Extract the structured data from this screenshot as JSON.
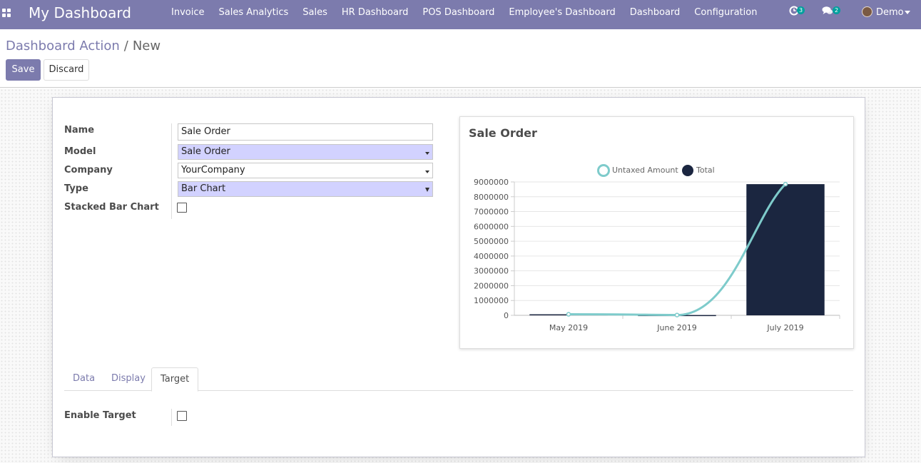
{
  "navbar": {
    "brand": "My Dashboard",
    "menu": [
      "Invoice",
      "Sales Analytics",
      "Sales",
      "HR Dashboard",
      "POS Dashboard",
      "Employee's Dashboard",
      "Dashboard",
      "Configuration"
    ],
    "activity_count": "3",
    "messages_count": "2",
    "user": "Demo"
  },
  "breadcrumb": {
    "parent": "Dashboard Action",
    "separator": "/",
    "current": "New"
  },
  "buttons": {
    "save": "Save",
    "discard": "Discard"
  },
  "form": {
    "name_label": "Name",
    "name_value": "Sale Order",
    "model_label": "Model",
    "model_value": "Sale Order",
    "company_label": "Company",
    "company_value": "YourCompany",
    "type_label": "Type",
    "type_value": "Bar Chart",
    "stacked_label": "Stacked Bar Chart",
    "stacked_checked": false
  },
  "tabs": {
    "data": "Data",
    "display": "Display",
    "target": "Target",
    "active": "Target"
  },
  "target": {
    "enable_label": "Enable Target",
    "enable_checked": false
  },
  "chart_data": {
    "type": "bar",
    "title": "Sale Order",
    "categories": [
      "May 2019",
      "June 2019",
      "July 2019"
    ],
    "series": [
      {
        "name": "Untaxed Amount",
        "type": "line",
        "values": [
          70000,
          20000,
          8850000
        ],
        "color": "#7ecbcb"
      },
      {
        "name": "Total",
        "type": "bar",
        "values": [
          70000,
          20000,
          8850000
        ],
        "color": "#1b2640"
      }
    ],
    "ylim": [
      0,
      9000000
    ],
    "yticks": [
      "0",
      "1000000",
      "2000000",
      "3000000",
      "4000000",
      "5000000",
      "6000000",
      "7000000",
      "8000000",
      "9000000"
    ],
    "legend": "top",
    "grid": true
  },
  "colors": {
    "brand": "#7c7bad",
    "badge": "#00a09d",
    "required_field": "#d2d2ff"
  }
}
